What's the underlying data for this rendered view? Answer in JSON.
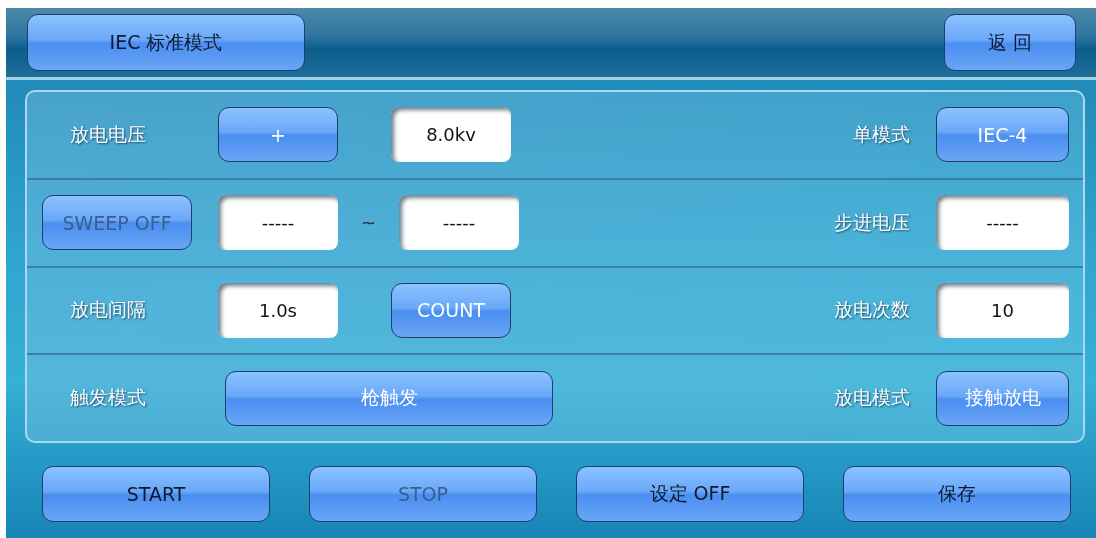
{
  "header": {
    "mode_button": {
      "text": "IEC 标准模式",
      "disabled": false
    },
    "back_button": {
      "text": "返 回",
      "disabled": false
    }
  },
  "settings_rows": [
    {
      "left": [
        {
          "kind": "label",
          "text": "放电电压"
        },
        {
          "kind": "button",
          "text": "+",
          "disabled": false
        },
        {
          "kind": "field",
          "value": "8.0kv"
        }
      ],
      "right": [
        {
          "kind": "label",
          "text": "单模式"
        },
        {
          "kind": "button",
          "text": "IEC-4",
          "disabled": false
        }
      ]
    },
    {
      "left": [
        {
          "kind": "button",
          "text": "SWEEP OFF",
          "disabled": true
        },
        {
          "kind": "field",
          "value": "-----"
        },
        {
          "kind": "text",
          "text": "~"
        },
        {
          "kind": "field",
          "value": "-----"
        }
      ],
      "right": [
        {
          "kind": "label",
          "text": "步进电压"
        },
        {
          "kind": "field",
          "value": "-----"
        }
      ]
    },
    {
      "left": [
        {
          "kind": "label",
          "text": "放电间隔"
        },
        {
          "kind": "field",
          "value": "1.0s"
        },
        {
          "kind": "button",
          "text": "COUNT",
          "disabled": false
        }
      ],
      "right": [
        {
          "kind": "label",
          "text": "放电次数"
        },
        {
          "kind": "field",
          "value": "10"
        }
      ]
    },
    {
      "left": [
        {
          "kind": "label",
          "text": "触发模式"
        },
        {
          "kind": "button",
          "text": "枪触发",
          "disabled": false
        }
      ],
      "right": [
        {
          "kind": "label",
          "text": "放电模式"
        },
        {
          "kind": "button",
          "text": "接触放电",
          "disabled": false
        }
      ]
    }
  ],
  "footer_buttons": [
    {
      "text": "START",
      "disabled": false
    },
    {
      "text": "STOP",
      "disabled": true
    },
    {
      "text": "设定 OFF",
      "disabled": false
    },
    {
      "text": "保存",
      "disabled": false
    }
  ]
}
